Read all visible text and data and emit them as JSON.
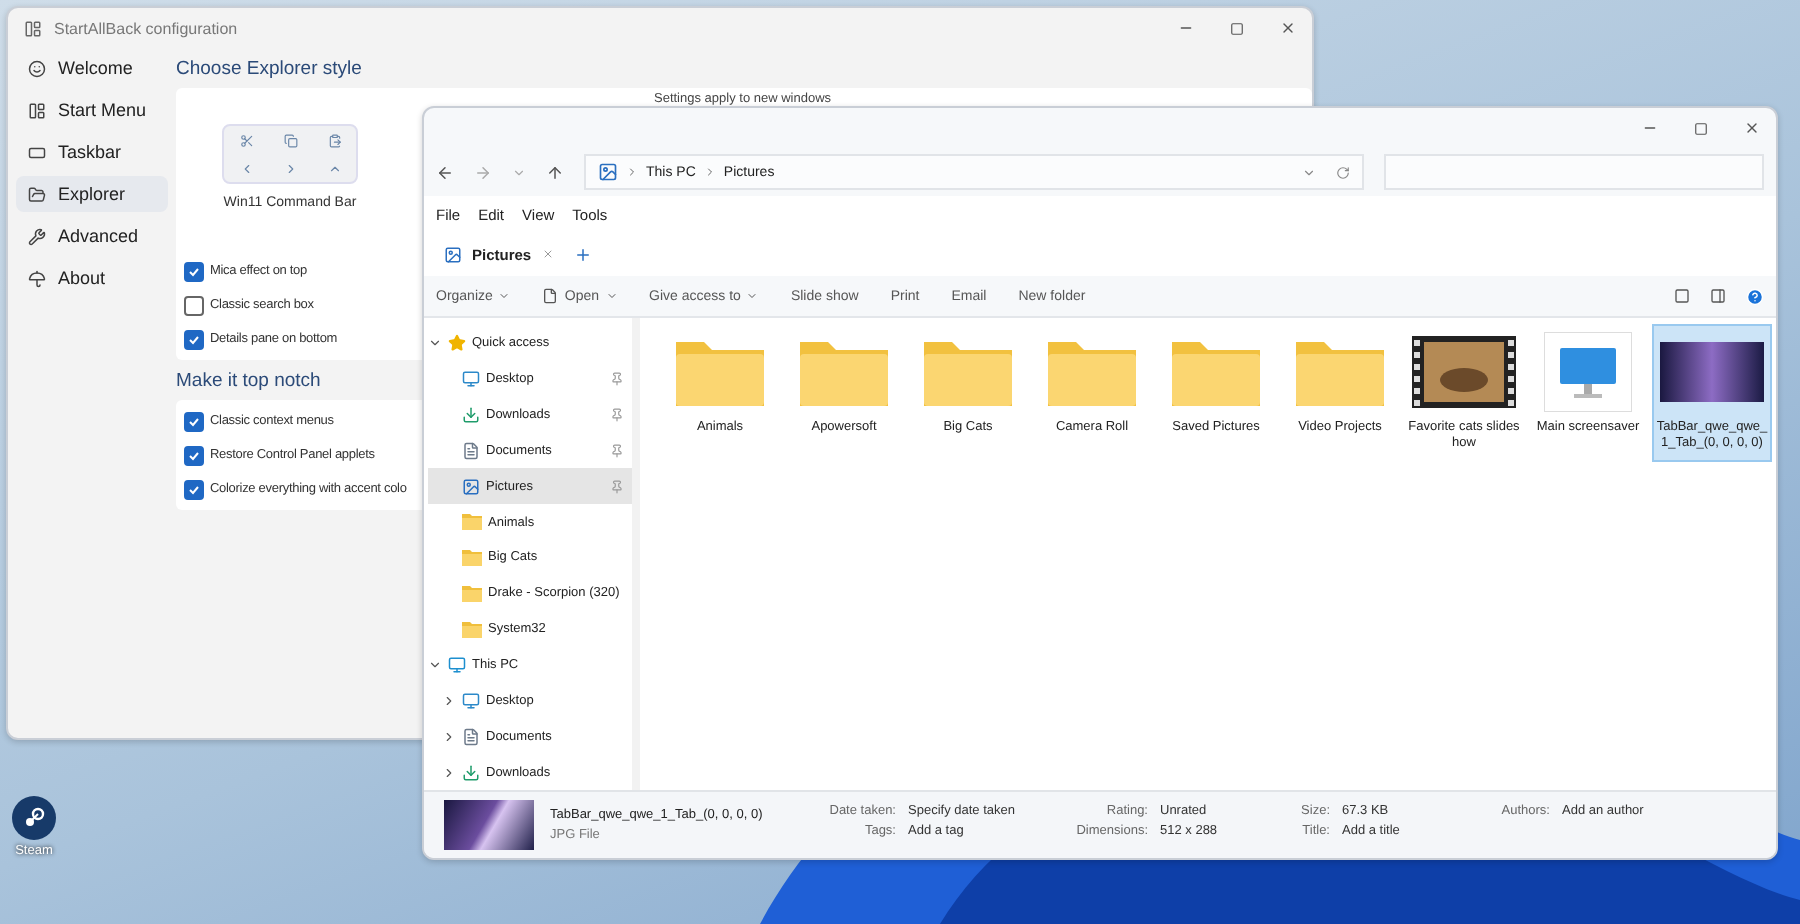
{
  "config_window": {
    "title": "StartAllBack configuration",
    "sidebar": [
      {
        "label": "Welcome",
        "selected": false
      },
      {
        "label": "Start Menu",
        "selected": false
      },
      {
        "label": "Taskbar",
        "selected": false
      },
      {
        "label": "Explorer",
        "selected": true
      },
      {
        "label": "Advanced",
        "selected": false
      },
      {
        "label": "About",
        "selected": false
      }
    ],
    "sections": [
      {
        "heading": "Choose Explorer style",
        "preview": {
          "label": "Win11 Command Bar",
          "caption": "Settings apply to new windows"
        },
        "options": [
          {
            "label": "Mica effect on top",
            "checked": true
          },
          {
            "label": "Classic search box",
            "checked": false
          },
          {
            "label": "Details pane on bottom",
            "checked": true
          }
        ]
      },
      {
        "heading": "Make it top notch",
        "options": [
          {
            "label": "Classic context menus",
            "checked": true
          },
          {
            "label": "Restore Control Panel applets",
            "checked": true
          },
          {
            "label": "Colorize everything with accent colo",
            "checked": true
          }
        ]
      }
    ]
  },
  "explorer": {
    "breadcrumb": [
      "This PC",
      "Pictures"
    ],
    "menu": [
      "File",
      "Edit",
      "View",
      "Tools"
    ],
    "tabs": [
      {
        "label": "Pictures",
        "selected": true
      }
    ],
    "commands": [
      {
        "label": "Organize",
        "dropdown": true
      },
      {
        "label": "Open",
        "dropdown": true
      },
      {
        "label": "Give access to",
        "dropdown": true
      },
      {
        "label": "Slide show",
        "dropdown": false
      },
      {
        "label": "Print",
        "dropdown": false
      },
      {
        "label": "Email",
        "dropdown": false
      },
      {
        "label": "New folder",
        "dropdown": false
      }
    ],
    "tree": [
      {
        "label": "Quick access",
        "kind": "star",
        "expanded": true,
        "selected": false,
        "children": [
          {
            "label": "Desktop",
            "kind": "desktop",
            "pinned": true,
            "selected": false
          },
          {
            "label": "Downloads",
            "kind": "download",
            "pinned": true,
            "selected": false
          },
          {
            "label": "Documents",
            "kind": "document",
            "pinned": true,
            "selected": false
          },
          {
            "label": "Pictures",
            "kind": "picture",
            "pinned": true,
            "selected": true
          },
          {
            "label": "Animals",
            "kind": "folder",
            "pinned": false,
            "selected": false
          },
          {
            "label": "Big Cats",
            "kind": "folder",
            "pinned": false,
            "selected": false
          },
          {
            "label": "Drake - Scorpion (320)",
            "kind": "folder",
            "pinned": false,
            "selected": false
          },
          {
            "label": "System32",
            "kind": "folder",
            "pinned": false,
            "selected": false
          }
        ]
      },
      {
        "label": "This PC",
        "kind": "pc",
        "expanded": true,
        "selected": false,
        "children": [
          {
            "label": "Desktop",
            "kind": "desktop",
            "expanded": false,
            "selected": false
          },
          {
            "label": "Documents",
            "kind": "document",
            "expanded": false,
            "selected": false
          },
          {
            "label": "Downloads",
            "kind": "download",
            "expanded": false,
            "selected": false
          }
        ]
      }
    ],
    "items": [
      {
        "label": "Animals",
        "kind": "folder",
        "selected": false
      },
      {
        "label": "Apowersoft",
        "kind": "folder",
        "selected": false
      },
      {
        "label": "Big Cats",
        "kind": "folder",
        "selected": false
      },
      {
        "label": "Camera Roll",
        "kind": "folder",
        "selected": false
      },
      {
        "label": "Saved Pictures",
        "kind": "folder",
        "selected": false
      },
      {
        "label": "Video Projects",
        "kind": "folder",
        "selected": false
      },
      {
        "label": "Favorite cats slideshow",
        "kind": "video",
        "selected": false
      },
      {
        "label": "Main screensaver",
        "kind": "screensaver",
        "selected": false
      },
      {
        "label": "TabBar_qwe_qwe_1_Tab_(0, 0, 0, 0)",
        "kind": "image",
        "selected": true
      }
    ],
    "details": {
      "name": "TabBar_qwe_qwe_1_Tab_(0, 0, 0, 0)",
      "type": "JPG File",
      "fields": [
        {
          "label": "Date taken:",
          "value": "Specify date taken"
        },
        {
          "label": "Rating:",
          "value": "Unrated"
        },
        {
          "label": "Size:",
          "value": "67.3 KB"
        },
        {
          "label": "Authors:",
          "value": "Add an author"
        },
        {
          "label": "Tags:",
          "value": "Add a tag"
        },
        {
          "label": "Dimensions:",
          "value": "512 x 288"
        },
        {
          "label": "Title:",
          "value": "Add a title"
        }
      ]
    }
  },
  "desktop_icons": [
    {
      "label": "Steam"
    }
  ]
}
